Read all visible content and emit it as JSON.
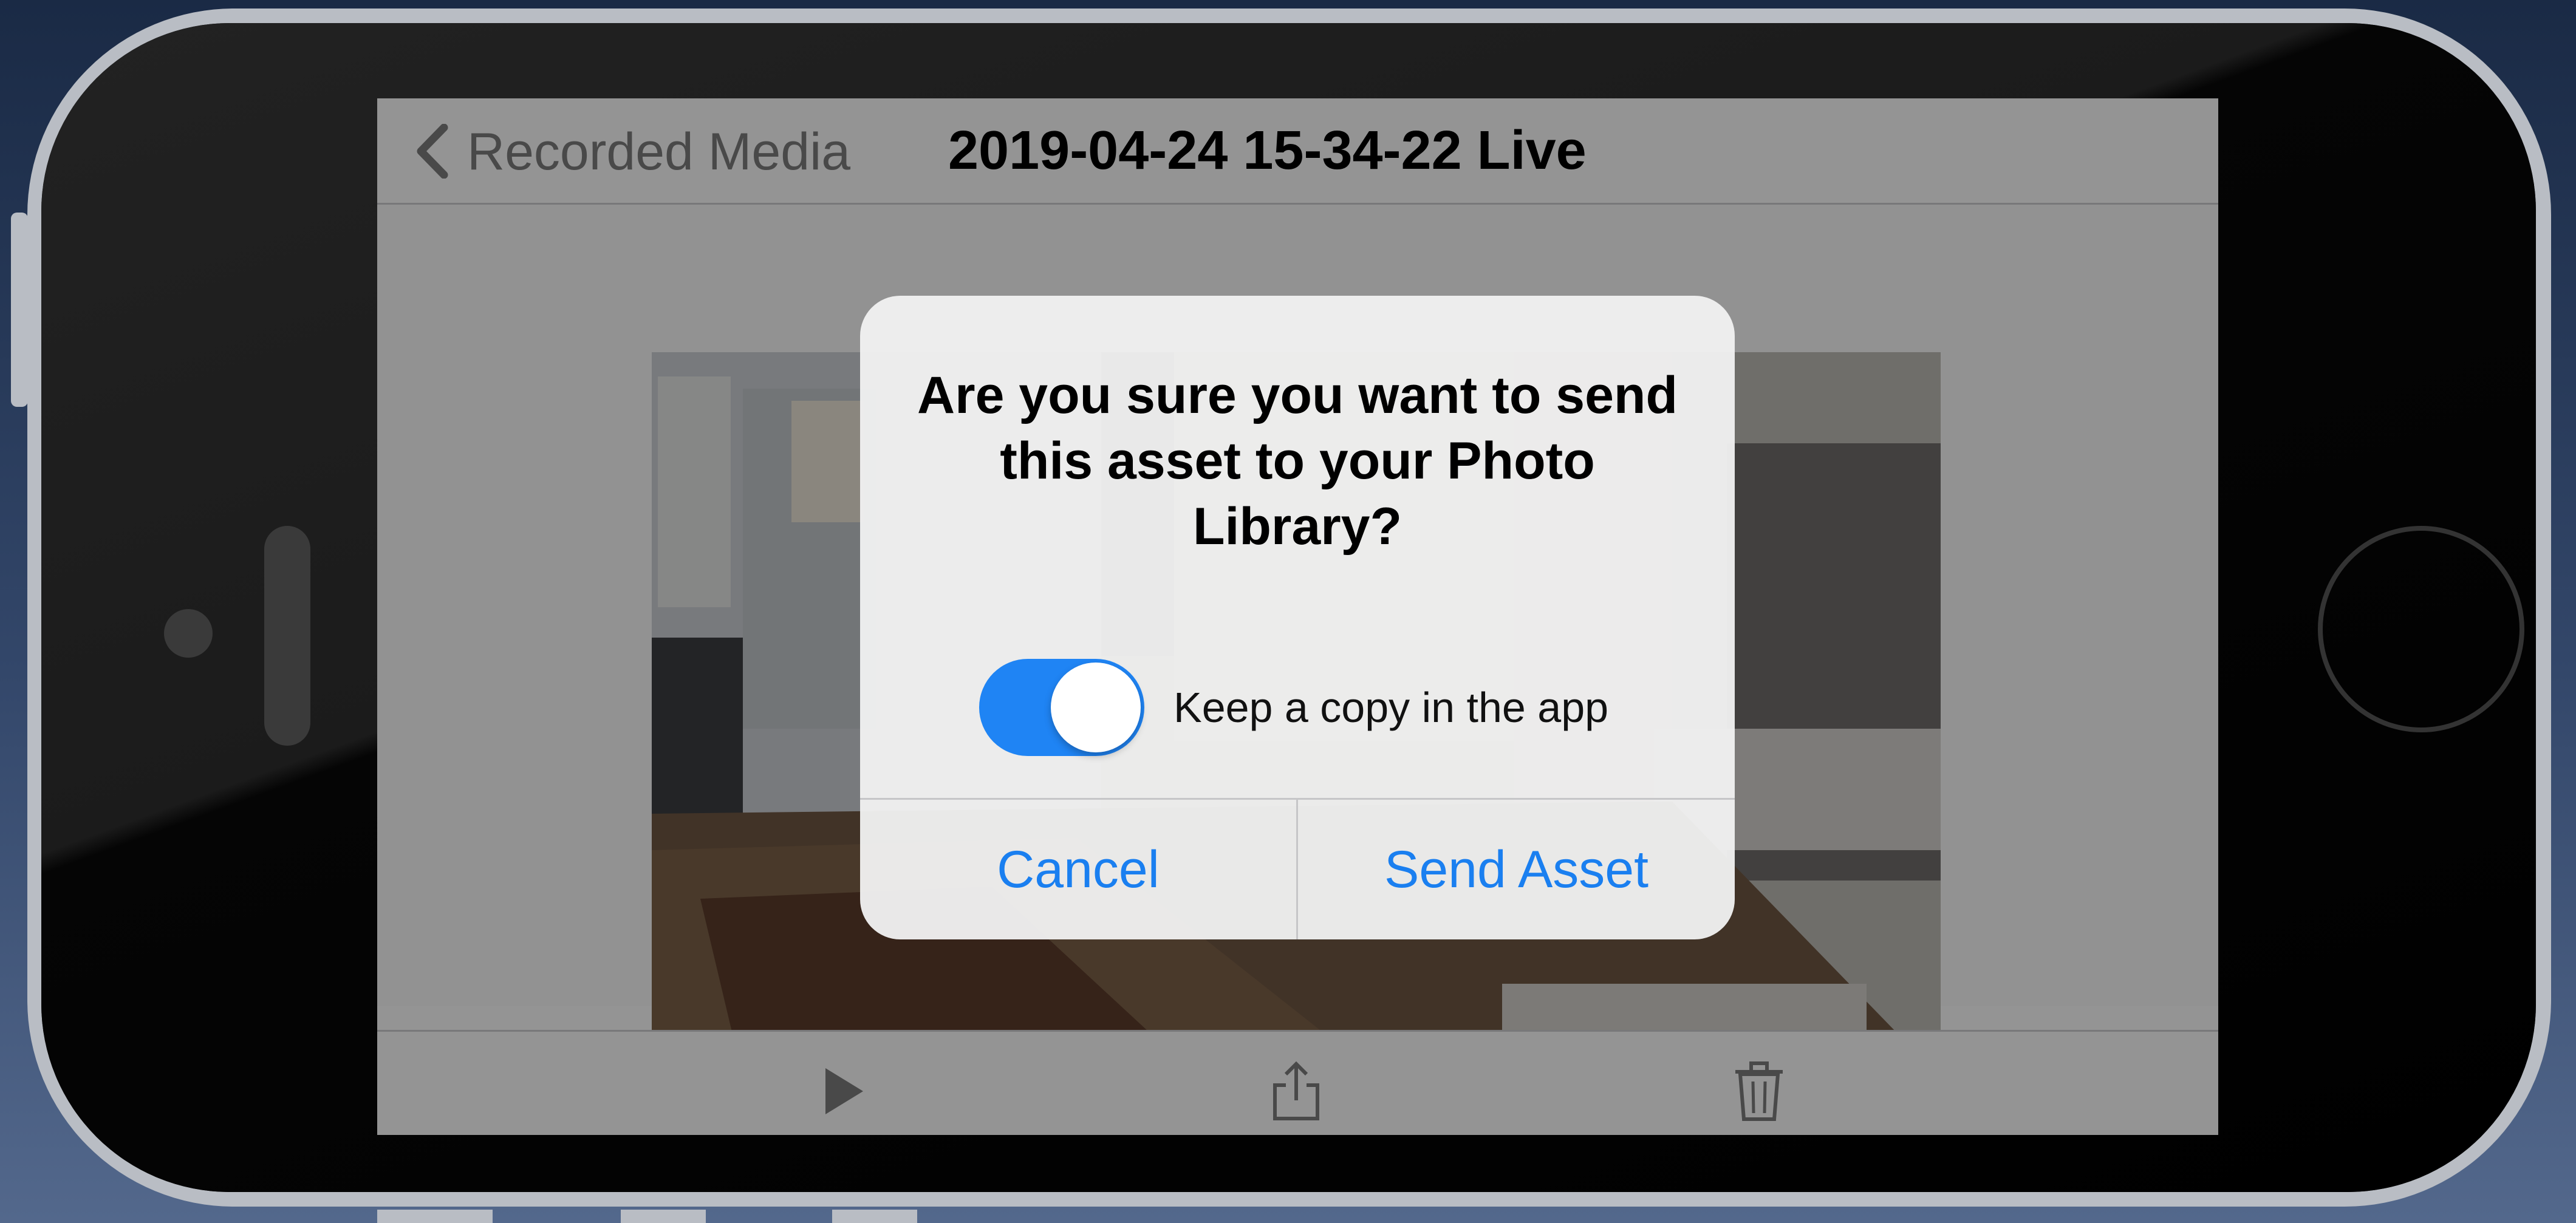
{
  "nav": {
    "back_label": "Recorded Media",
    "title": "2019-04-24 15-34-22 Live"
  },
  "icons": {
    "back": "chevron-left-icon",
    "play": "play-icon",
    "share": "share-icon",
    "delete": "trash-icon"
  },
  "alert": {
    "title": "Are you sure you want to send this asset to your Photo Library?",
    "toggle_label": "Keep a copy in the app",
    "toggle_on": true,
    "cancel_label": "Cancel",
    "confirm_label": "Send Asset"
  },
  "colors": {
    "accent": "#1a7ff0",
    "toggle_on": "#1f84f4"
  }
}
